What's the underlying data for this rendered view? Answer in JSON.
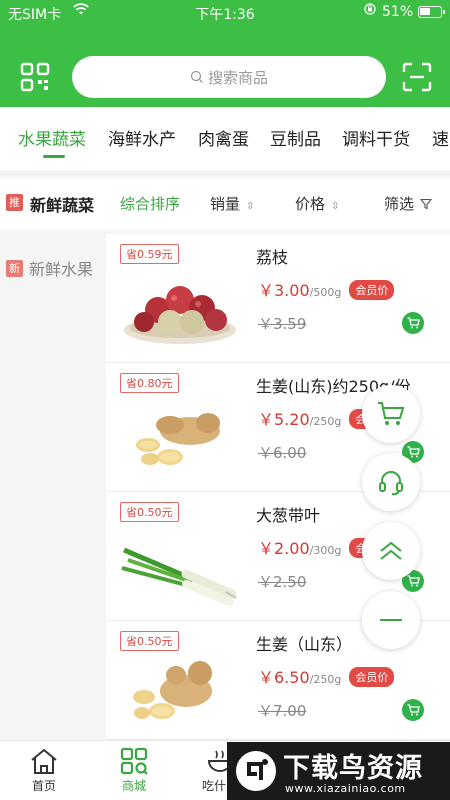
{
  "status": {
    "carrier": "无SIM卡",
    "time": "下午1:36",
    "battery": "51%"
  },
  "search": {
    "placeholder": "搜索商品"
  },
  "tabs": [
    "水果蔬菜",
    "海鲜水产",
    "肉禽蛋",
    "豆制品",
    "调料干货",
    "速"
  ],
  "filter": {
    "badge": "推",
    "title": "新鲜蔬菜",
    "sort_default": "综合排序",
    "sort_sales": "销量",
    "sort_price": "价格",
    "filter_label": "筛选"
  },
  "sidebar": {
    "items": [
      {
        "badge": "新",
        "label": "新鲜水果"
      }
    ]
  },
  "products": [
    {
      "save": "省0.59元",
      "name": "荔枝",
      "price": "￥3.00",
      "unit": "/500g",
      "member": "会员价",
      "old_price": "￥3.59",
      "image": "lychee"
    },
    {
      "save": "省0.80元",
      "name": "生姜(山东)约250g/份",
      "price": "￥5.20",
      "unit": "/250g",
      "member": "会员价",
      "old_price": "￥6.00",
      "image": "ginger"
    },
    {
      "save": "省0.50元",
      "name": "大葱带叶",
      "price": "￥2.00",
      "unit": "/300g",
      "member": "会员价",
      "old_price": "￥2.50",
      "image": "scallion"
    },
    {
      "save": "省0.50元",
      "name": "生姜（山东）",
      "price": "￥6.50",
      "unit": "/250g",
      "member": "会员价",
      "old_price": "￥7.00",
      "image": "ginger"
    }
  ],
  "nav": [
    {
      "label": "首页",
      "icon": "home-icon"
    },
    {
      "label": "商城",
      "icon": "mall-icon"
    },
    {
      "label": "吃什么",
      "icon": "bowl-icon"
    }
  ],
  "watermark": {
    "title": "下载鸟资源",
    "url": "www.xiazainiao.com"
  },
  "colors": {
    "brand_green": "#3dbf45",
    "price_red": "#d33a34",
    "cart_green": "#2fb24a"
  }
}
